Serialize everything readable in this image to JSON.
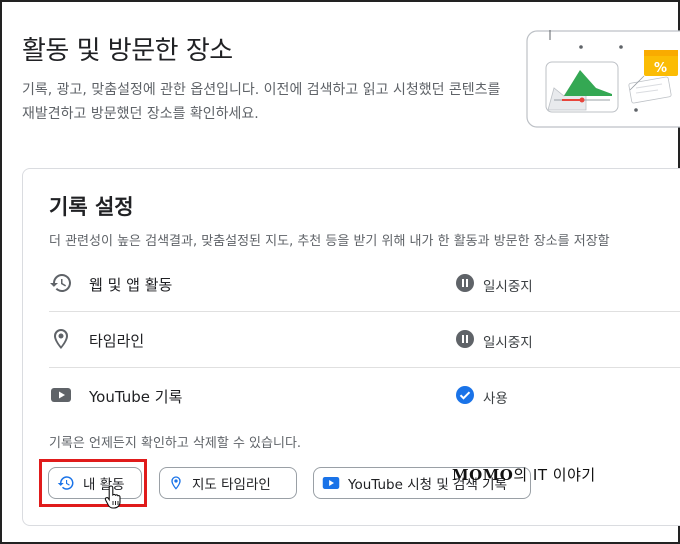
{
  "page": {
    "title": "활동 및 방문한 장소",
    "description": "기록, 광고, 맞춤설정에 관한 옵션입니다. 이전에 검색하고 읽고 시청했던 콘텐츠를 재발견하고 방문했던 장소를 확인하세요."
  },
  "history_settings": {
    "title": "기록 설정",
    "description": "더 관련성이 높은 검색결과, 맞춤설정된 지도, 추천 등을 받기 위해 내가 한 활동과 방문한 장소를 저장할",
    "rows": [
      {
        "label": "웹 및 앱 활동",
        "status": "일시중지",
        "icon": "history-icon",
        "status_icon": "pause-icon"
      },
      {
        "label": "타임라인",
        "status": "일시중지",
        "icon": "location-pin-icon",
        "status_icon": "pause-icon"
      },
      {
        "label": "YouTube 기록",
        "status": "사용",
        "icon": "youtube-icon",
        "status_icon": "check-circle-icon"
      }
    ],
    "footnote": "기록은 언제든지 확인하고 삭제할 수 있습니다."
  },
  "buttons": {
    "my_activity": "내 활동",
    "maps_timeline": "지도 타임라인",
    "youtube_history": "YouTube 시청 및 검색 기록"
  },
  "watermark": {
    "brand": "MOMO",
    "rest": "의 IT 이야기"
  },
  "colors": {
    "accent_blue": "#1a73e8",
    "highlight_red": "#e01b1b",
    "pause_gray": "#5f6368"
  }
}
